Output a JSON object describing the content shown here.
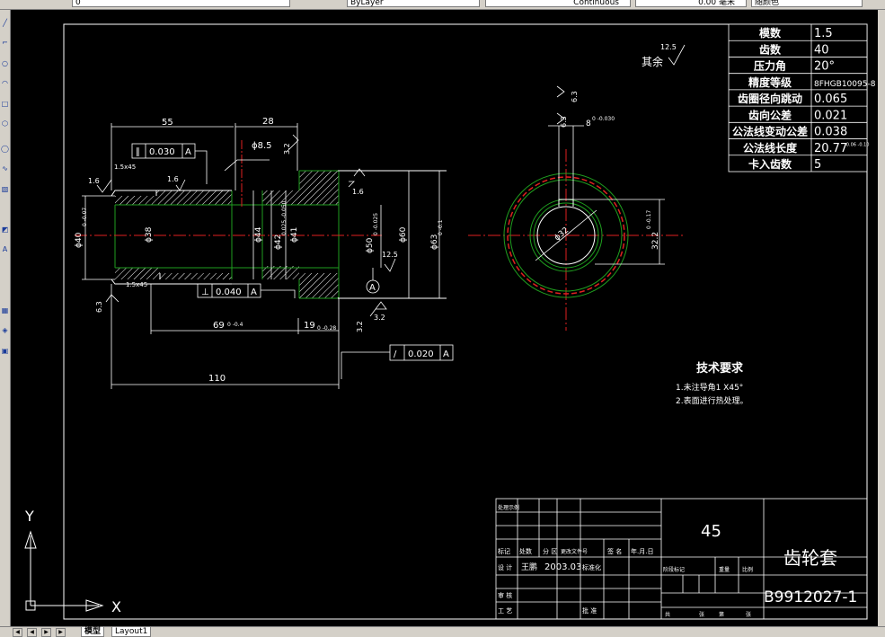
{
  "toolbar": {
    "color_value": "0",
    "layer_value": "ByLayer",
    "linetype_value": "Continuous",
    "lineweight_value": "0.00 毫米",
    "plotstyle_value": "随颜色"
  },
  "left_toolbar_icons": [
    "line-icon",
    "polyline-icon",
    "circle-icon",
    "arc-icon",
    "rectangle-icon",
    "polygon-icon",
    "ellipse-icon",
    "spline-icon",
    "hatch-icon",
    "region-icon",
    "text-icon",
    "table-icon",
    "block-icon",
    "insert-icon"
  ],
  "layout_tabs": {
    "model": "模型",
    "layout1": "Layout1"
  },
  "ucs": {
    "x_label": "X",
    "y_label": "Y"
  },
  "drawing": {
    "qita_label": "其余",
    "qita_roughness": "12.5",
    "dim_55": "55",
    "dim_28": "28",
    "dim_110": "110",
    "dim_69": "69",
    "dim_69_tol": "0 -0.4",
    "dim_19": "19",
    "dim_19_tol": "0 -0.28",
    "dim_phi85": "ϕ8.5",
    "dim_phi40": "ϕ40",
    "dim_phi40_tol": "0 -0.07",
    "dim_phi38": "ϕ38",
    "dim_phi44": "ϕ44",
    "dim_phi42": "ϕ42",
    "dim_phi42_tol": "0.025 -0.050",
    "dim_phi41": "ϕ41",
    "dim_phi50": "ϕ50",
    "dim_phi50_tol": "0 -0.025",
    "dim_phi60": "ϕ60",
    "dim_phi63": "ϕ63",
    "dim_phi63_tol": "0 -0.1",
    "chamfer_1": "1.5x45",
    "chamfer_2": "1.5x45",
    "rough_16a": "1.6",
    "rough_16b": "1.6",
    "rough_16c": "1.6",
    "rough_32a": "3.2",
    "rough_32b": "3.2",
    "rough_32c": "3.2",
    "rough_63": "6.3",
    "rough_125": "12.5",
    "tol_frame_1_sym": "∥",
    "tol_frame_1_val": "0.030",
    "tol_frame_1_ref": "A",
    "tol_frame_2_sym": "⊥",
    "tol_frame_2_val": "0.040",
    "tol_frame_2_ref": "A",
    "tol_frame_3_sym": "/",
    "tol_frame_3_val": "0.020",
    "tol_frame_3_ref": "A",
    "datum_label": "A",
    "side_rough_63": "6.3",
    "side_rough_63b": "6.3",
    "side_dim_8": "8",
    "side_dim_8_tol": "0 -0.030",
    "side_dim_phi32": "ϕ32",
    "side_dim_322": "32.2",
    "side_dim_322_tol": "0 -0.17"
  },
  "gear_table": [
    {
      "label": "模数",
      "value": "1.5"
    },
    {
      "label": "齿数",
      "value": "40"
    },
    {
      "label": "压力角",
      "value": "20°"
    },
    {
      "label": "精度等级",
      "value": "8FHGB10095-8"
    },
    {
      "label": "齿圈径向跳动",
      "value": "0.065"
    },
    {
      "label": "齿向公差",
      "value": "0.021"
    },
    {
      "label": "公法线变动公差",
      "value": "0.038"
    },
    {
      "label": "公法线长度",
      "value": "20.77"
    },
    {
      "label": "卡入齿数",
      "value": "5"
    }
  ],
  "gear_table_extra": {
    "wkl_tol": "-0.06 -0.10"
  },
  "tech_req": {
    "title": "技术要求",
    "line1": "1.未注导角1 X45°",
    "line2": "2.表面进行热处理。"
  },
  "title_block": {
    "material": "45",
    "part_name": "齿轮套",
    "drawing_no": "B9912027-1",
    "label_biaoji": "标记",
    "label_chushu": "处数",
    "label_fenqu": "分 区",
    "label_gengai": "更改文件号",
    "label_qianming": "签 名",
    "label_nianyueri": "年.月.日",
    "label_sheji": "设 计",
    "designer": "王鹏",
    "date": "2003.03",
    "label_biaozhunhua": "标准化",
    "label_shenhe": "审 核",
    "label_gongyi": "工 艺",
    "label_pizhun": "批 准",
    "label_jieduan": "阶段标记",
    "label_zhongliang": "重量",
    "label_bili": "比例",
    "label_gong": "共",
    "label_zhang": "张",
    "label_di": "第",
    "label_zhang2": "张",
    "label_top": "处理示例"
  }
}
